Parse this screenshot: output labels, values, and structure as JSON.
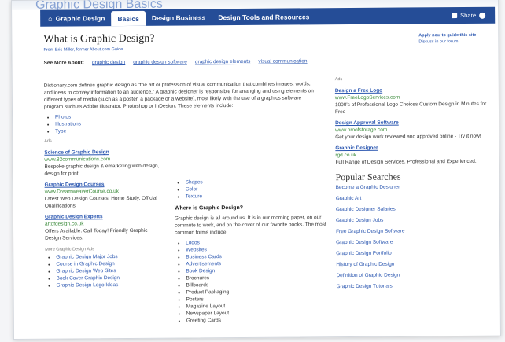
{
  "topbar": {
    "blur_title": "Graphic Design Basics"
  },
  "nav": {
    "home": "Graphic Design",
    "tabs": [
      {
        "label": "Basics"
      },
      {
        "label": "Design Business"
      },
      {
        "label": "Design Tools and Resources"
      }
    ],
    "share": "Share"
  },
  "page": {
    "title": "What is Graphic Design?",
    "byline": "From Eric Miller, former About.com Guide",
    "apply_line": "Apply now to guide this site",
    "discuss_line": "Discuss in our forum",
    "see_more_label": "See More About:",
    "see_more": [
      "graphic design",
      "graphic design software",
      "graphic design elements",
      "visual communication"
    ],
    "intro": "Dictionary.com defines graphic design as \"the art or profession of visual communication that combines images, words, and ideas to convey information to an audience.\" A graphic designer is responsible for arranging and using elements on different types of media (such as a poster, a package or a website), most likely with the use of a graphics software program such as Adobe Illustrator, Photoshop or InDesign. These elements include:",
    "elements_left": [
      "Photos",
      "Illustrations",
      "Type"
    ],
    "elements_right": [
      "Shapes",
      "Color",
      "Texture"
    ],
    "where_title": "Where is Graphic Design?",
    "where_body": "Graphic design is all around us. It is in our morning paper, on our commute to work, and on the cover of our favorite books. The most common forms include:",
    "forms": [
      "Logos",
      "Websites",
      "Business Cards",
      "Advertisements",
      "Book Design",
      "Brochures",
      "Billboards",
      "Product Packaging",
      "Posters",
      "Magazine Layout",
      "Newspaper Layout",
      "Greeting Cards"
    ]
  },
  "ads_left": {
    "label": "Ads",
    "items": [
      {
        "title": "Science of Graphic Design",
        "url": "www.82communications.com",
        "body": "Bespoke graphic design & emarketing web design, design for print"
      },
      {
        "title": "Graphic Design Courses",
        "url": "www.DreamweaverCourse.co.uk",
        "body": "Latest Web Design Courses. Home Study. Official Qualifications"
      },
      {
        "title": "Graphic Design Experts",
        "url": "artofdesign.co.uk",
        "body": "Offers Available. Call Today! Friendly Graphic Design Services."
      }
    ],
    "more_label": "More Graphic Design Ads",
    "more": [
      "Graphic Design Major Jobs",
      "Course in Graphic Design",
      "Graphic Design Web Sites",
      "Book Cover Graphic Design",
      "Graphic Design Logo Ideas"
    ]
  },
  "ads_right": {
    "label": "Ads",
    "items": [
      {
        "title": "Design a Free Logo",
        "url": "www.FreeLogoServices.com",
        "body": "1000's of Professional Logo Choices Custom Design in Minutes for Free"
      },
      {
        "title": "Design Approval Software",
        "url": "www.proofstorage.com",
        "body": "Get your design work reviewed and approved online - Try it now!"
      },
      {
        "title": "Graphic Designer",
        "url": "rgd.co.uk",
        "body": "Full Range of Design Services. Professional and Experienced."
      }
    ]
  },
  "popular": {
    "title": "Popular Searches",
    "items": [
      "Become a Graphic Designer",
      "Graphic Art",
      "Graphic Designer Salaries",
      "Graphic Design Jobs",
      "Free Graphic Design Software",
      "Graphic Design Software",
      "Graphic Design Portfolio",
      "History of Graphic Design",
      "Definition of Graphic Design",
      "Graphic Design Tutorials"
    ]
  }
}
